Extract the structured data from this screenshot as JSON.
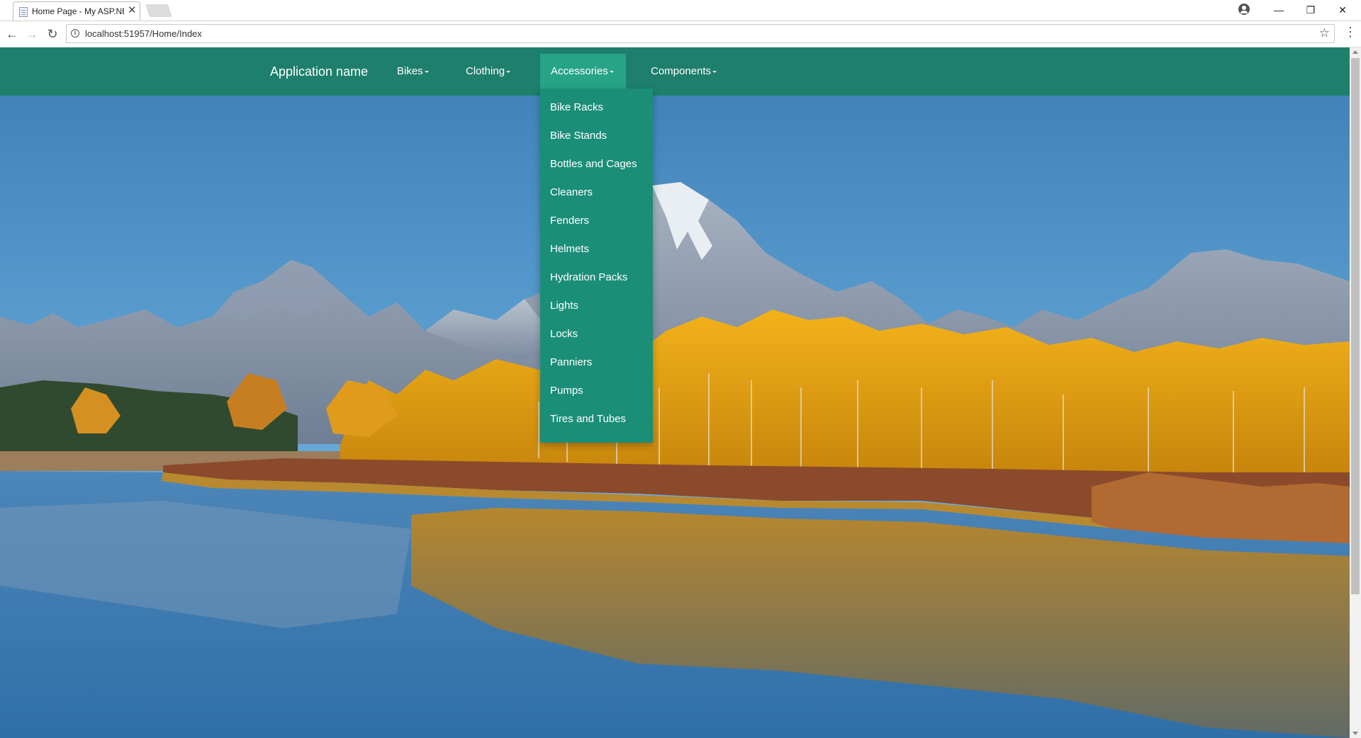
{
  "browser": {
    "tab_title": "Home Page - My ASP.NE",
    "tab_close": "✕",
    "url": "localhost:51957/Home/Index",
    "icons": [
      "back-icon",
      "forward-icon",
      "reload-icon",
      "info-icon",
      "star-icon",
      "menu-icon",
      "profile-icon"
    ],
    "window_controls": {
      "minimize": "—",
      "restore": "❐",
      "close": "✕"
    }
  },
  "navbar": {
    "brand": "Application name",
    "items": [
      {
        "label": "Bikes"
      },
      {
        "label": "Clothing"
      },
      {
        "label": "Accessories",
        "active": true
      },
      {
        "label": "Components"
      }
    ],
    "color": "#1e7f6c",
    "active_color": "#27a486"
  },
  "dropdown": {
    "items": [
      "Bike Racks",
      "Bike Stands",
      "Bottles and Cages",
      "Cleaners",
      "Fenders",
      "Helmets",
      "Hydration Packs",
      "Lights",
      "Locks",
      "Panniers",
      "Pumps",
      "Tires and Tubes"
    ],
    "color": "#1b8e78"
  },
  "background": {
    "description_icon": "mountain-lake-autumn-photo"
  }
}
